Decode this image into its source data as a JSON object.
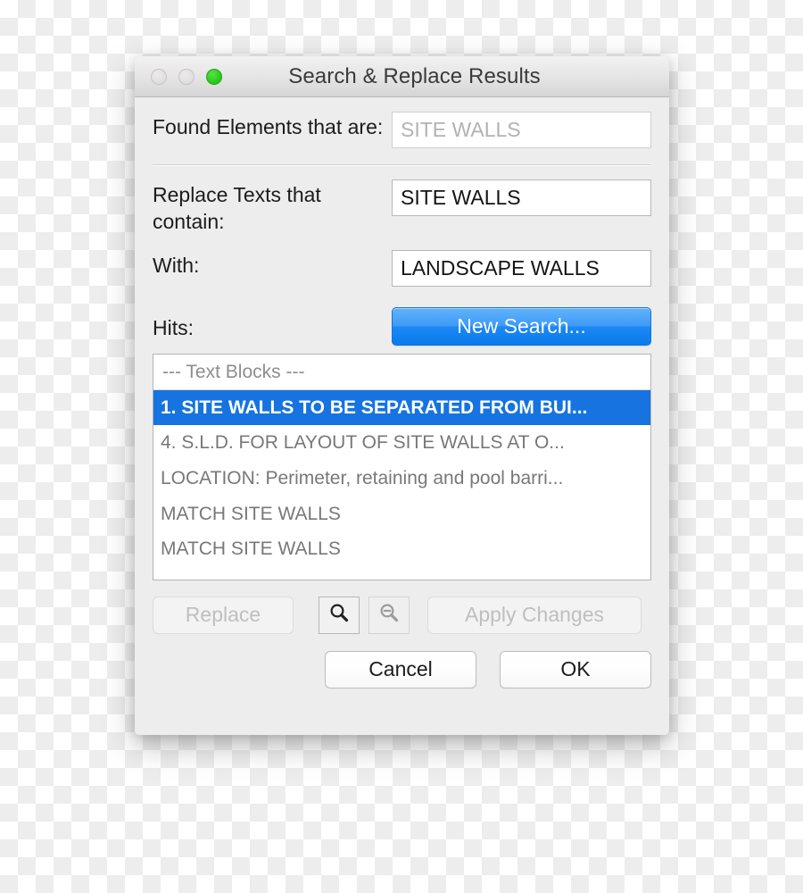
{
  "window": {
    "title": "Search & Replace Results",
    "traffic_lights": [
      {
        "name": "close-button",
        "color": "#e0dede",
        "state": "disabled"
      },
      {
        "name": "minimize-button",
        "color": "#e0dede",
        "state": "disabled"
      },
      {
        "name": "zoom-button",
        "color": "#2fcd1f",
        "state": "enabled"
      }
    ]
  },
  "form": {
    "found_elements": {
      "label": "Found Elements that are:",
      "value": "SITE WALLS",
      "disabled": true
    },
    "replace_texts": {
      "label": "Replace Texts that contain:",
      "value": "SITE WALLS"
    },
    "with": {
      "label": "With:",
      "value": "LANDSCAPE WALLS"
    },
    "new_search_label": "New Search..."
  },
  "hits": {
    "label": "Hits:",
    "header": "---  Text Blocks  ---",
    "items": [
      {
        "text": "1. SITE WALLS TO BE SEPARATED FROM BUI...",
        "selected": true
      },
      {
        "text": "4.  S.L.D. FOR LAYOUT OF SITE WALLS AT O...",
        "selected": false
      },
      {
        "text": "LOCATION: Perimeter, retaining and pool barri...",
        "selected": false
      },
      {
        "text": "MATCH SITE WALLS",
        "selected": false
      },
      {
        "text": "MATCH SITE WALLS",
        "selected": false
      }
    ]
  },
  "actions": {
    "replace_label": "Replace",
    "apply_changes_label": "Apply Changes",
    "zoom_in_icon": "magnifier-icon",
    "zoom_out_icon": "magnifier-minus-icon"
  },
  "footer": {
    "cancel_label": "Cancel",
    "ok_label": "OK"
  },
  "colors": {
    "accent_blue": "#1b88f4",
    "selection_blue": "#1673e0",
    "green_light": "#2fcd1f",
    "window_chrome": "#ededed"
  }
}
